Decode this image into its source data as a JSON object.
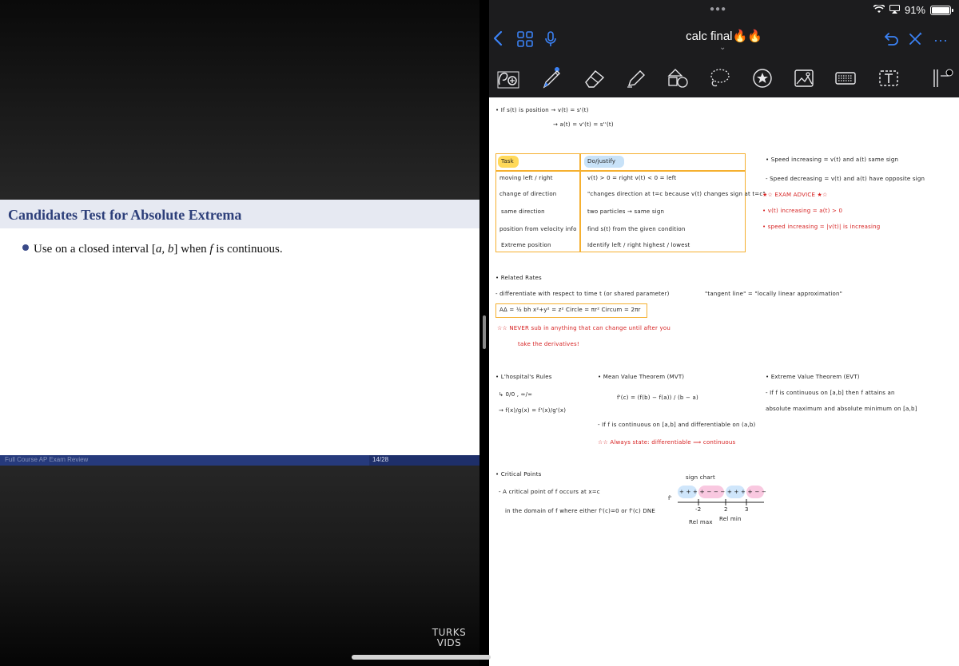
{
  "slide": {
    "title": "Candidates Test for Absolute Extrema",
    "bullet_prefix": "Use on a closed interval [",
    "bullet_interval": "a, b",
    "bullet_mid": "] when ",
    "bullet_var": "f",
    "bullet_suffix": " is continuous.",
    "footer_course": "Full Course AP Exam Review",
    "footer_page": "14/28"
  },
  "watermark": {
    "line1": "TURKS",
    "line2": "VIDS"
  },
  "app": {
    "doc_title": "calc final🔥🔥",
    "battery": "91%",
    "toolbar_icons": [
      "back-icon",
      "grid-icon",
      "microphone-icon",
      "undo-icon",
      "close-icon",
      "more-icon"
    ],
    "tools": [
      "lasso-search-icon",
      "pen-icon",
      "eraser-icon",
      "highlighter-icon",
      "shapes-icon",
      "lasso-icon",
      "sticker-icon",
      "image-icon",
      "keyboard-icon",
      "textbox-icon",
      "more-tools-icon"
    ]
  },
  "notes": {
    "pos1": "• If s(t) is position  → v(t) = s'(t)",
    "pos2": "→ a(t) = v'(t) = s''(t)",
    "table_header_task": "Task",
    "table_header_dol": "Do/justify",
    "rows": [
      {
        "task": "moving left / right",
        "dol": "v(t) > 0 = right   v(t) < 0 = left"
      },
      {
        "task": "change of direction",
        "dol": "\"changes direction at t=c because v(t) changes sign at t=c\""
      },
      {
        "task": "same direction",
        "dol": "two particles → same sign"
      },
      {
        "task": "position from velocity info",
        "dol": "find s(t) from the given condition"
      },
      {
        "task": "Extreme position",
        "dol": "Identify left / right   highest / lowest"
      }
    ],
    "speed1": "• Speed increasing = v(t) and a(t) same sign",
    "speed2": "- Speed decreasing = v(t) and a(t) have opposite sign",
    "exam_advice": "★☆ EXAM ADVICE ★☆",
    "vinc": "• v(t) increasing =   a(t) > 0",
    "sinc": "• speed increasing =   |v(t)| is increasing",
    "related": "• Related Rates",
    "differentiate": "- differentiate with respect to time t (or shared parameter)",
    "formula_box": "AΔ = ½ bh      x²+y² = z²      Circle = πr²      Circum = 2πr",
    "never_sub": "☆☆ NEVER sub in anything that can change until after you",
    "take_derivs": "take the derivatives!",
    "tangent": "\"tangent line\" = \"locally linear approximation\"",
    "lhospital": "• L'hospital's Rules",
    "lh1": "↳  0/0 ,  ∞/∞",
    "lh2": "→  f(x)/g(x)  =  f'(x)/g'(x)",
    "mvt": "• Mean Value Theorem (MVT)",
    "mvt_formula": "f'(c) = (f(b) − f(a)) / (b − a)",
    "mvt_cond": "- If f is continuous on [a,b] and differentiable on (a,b)",
    "mvt_state": "☆☆ Always state: differentiable ⟹ continuous",
    "evt": "• Extreme Value Theorem (EVT)",
    "evt1": "- If f is continuous on [a,b] then f attains an",
    "evt2": "absolute maximum and absolute minimum on [a,b]",
    "critical": "• Critical Points",
    "crit1": "- A critical point of f occurs at x=c",
    "crit2": "in the domain of f where either f'(c)=0 or f'(c) DNE",
    "sign_chart": "sign chart",
    "sc_fprime": "f'",
    "sc_plus1": "+ + + +",
    "sc_minus": "− − − − −",
    "sc_plus2": "+ + + +",
    "sc_minus2": "− − −",
    "sc_m2": "-2",
    "sc_2": "2",
    "sc_3": "3",
    "rel_max": "Rel max",
    "rel_min": "Rel min"
  }
}
